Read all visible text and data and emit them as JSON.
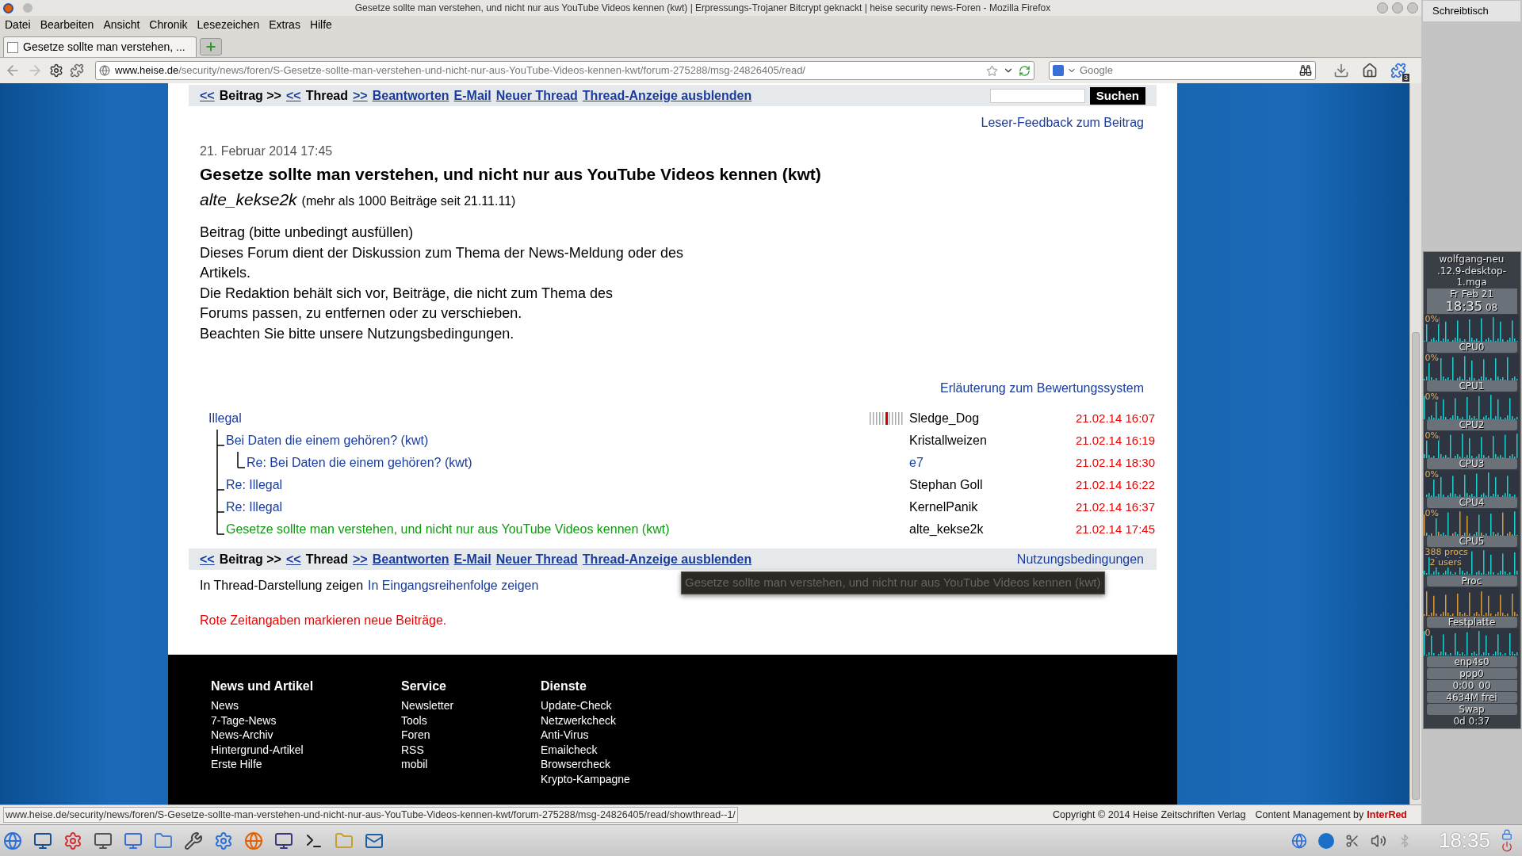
{
  "window": {
    "title": "Gesetze sollte man verstehen, und nicht nur aus YouTube Videos kennen (kwt) | Erpressungs-Trojaner Bitcrypt geknackt | heise security news-Foren - Mozilla Firefox"
  },
  "desktop_button": "Schreibtisch",
  "menu": [
    "Datei",
    "Bearbeiten",
    "Ansicht",
    "Chronik",
    "Lesezeichen",
    "Extras",
    "Hilfe"
  ],
  "tabs": [
    {
      "label": "Gesetze sollte man verstehen, ...",
      "selected": true
    }
  ],
  "address": {
    "host": "www.heise.de",
    "path": "/security/news/foren/S-Gesetze-sollte-man-verstehen-und-nicht-nur-aus-YouTube-Videos-kennen-kwt/forum-275288/msg-24826405/read/"
  },
  "search_engine": {
    "placeholder": "Google"
  },
  "addon_badge": "3",
  "forum_nav_top": {
    "items": [
      {
        "kind": "link",
        "text": "<<"
      },
      {
        "kind": "label",
        "text": "Beitrag >>"
      },
      {
        "kind": "link",
        "text": "<<"
      },
      {
        "kind": "label",
        "text": "Thread"
      },
      {
        "kind": "link",
        "text": ">>"
      },
      {
        "kind": "link",
        "text": "Beantworten"
      },
      {
        "kind": "link",
        "text": "E-Mail"
      },
      {
        "kind": "link",
        "text": "Neuer Thread"
      },
      {
        "kind": "link",
        "text": "Thread-Anzeige ausblenden"
      }
    ],
    "search_button": "Suchen"
  },
  "feedback_link": "Leser-Feedback zum Beitrag",
  "post": {
    "date": "21. Februar 2014 17:45",
    "title": "Gesetze sollte man verstehen, und nicht nur aus YouTube Videos kennen (kwt)",
    "author": "alte_kekse2k",
    "author_info": "(mehr als 1000 Beiträge seit 21.11.11)",
    "body": [
      "Beitrag (bitte unbedingt ausfüllen)",
      "Dieses Forum dient der Diskussion zum Thema der News-Meldung oder des",
      "Artikels.",
      "Die Redaktion behält sich vor, Beiträge, die nicht zum Thema des",
      "Forums passen, zu entfernen oder zu verschieben.",
      "Beachten Sie bitte unsere Nutzungsbedingungen."
    ]
  },
  "rating_link": "Erläuterung zum Bewertungssystem",
  "thread": [
    {
      "title": "Illegal",
      "author": "Sledge_Dog",
      "author_link": false,
      "time": "21.02.14 16:07",
      "new": true,
      "rated": true,
      "current": false,
      "children": [
        {
          "title": "Bei Daten die einem gehören? (kwt)",
          "author": "Kristallweizen",
          "author_link": false,
          "time": "21.02.14 16:19",
          "new": true,
          "rated": false,
          "current": false,
          "children": [
            {
              "title": "Re: Bei Daten die einem gehören? (kwt)",
              "author": "e7",
              "author_link": true,
              "time": "21.02.14 18:30",
              "new": true,
              "rated": false,
              "current": false
            }
          ]
        },
        {
          "title": "Re: Illegal",
          "author": "Stephan Goll",
          "author_link": false,
          "time": "21.02.14 16:22",
          "new": true,
          "rated": false,
          "current": false
        },
        {
          "title": "Re: Illegal",
          "author": "KernelPanik",
          "author_link": false,
          "time": "21.02.14 16:37",
          "new": true,
          "rated": false,
          "current": false
        },
        {
          "title": "Gesetze sollte man verstehen, und nicht nur aus YouTube Videos kennen (kwt)",
          "author": "alte_kekse2k",
          "author_link": false,
          "time": "21.02.14 17:45",
          "new": true,
          "rated": false,
          "current": true
        }
      ]
    }
  ],
  "forum_nav_bottom": {
    "items": [
      {
        "kind": "link",
        "text": "<<"
      },
      {
        "kind": "label",
        "text": "Beitrag >>"
      },
      {
        "kind": "link",
        "text": "<<"
      },
      {
        "kind": "label",
        "text": "Thread"
      },
      {
        "kind": "link",
        "text": ">>"
      },
      {
        "kind": "link",
        "text": "Beantworten"
      },
      {
        "kind": "link",
        "text": "E-Mail"
      },
      {
        "kind": "link",
        "text": "Neuer Thread"
      },
      {
        "kind": "link",
        "text": "Thread-Anzeige ausblenden"
      }
    ],
    "terms_link": "Nutzungsbedingungen"
  },
  "view_options": [
    {
      "text": "In Thread-Darstellung zeigen",
      "selected": true
    },
    {
      "text": "In Eingangsreihenfolge zeigen",
      "selected": false
    }
  ],
  "tooltip": "Gesetze sollte man verstehen, und nicht nur aus YouTube Videos kennen (kwt)",
  "legend_note": "Rote Zeitangaben markieren neue Beiträge.",
  "footer": [
    {
      "heading": "News und Artikel",
      "links": [
        "News",
        "7-Tage-News",
        "News-Archiv",
        "Hintergrund-Artikel",
        "Erste Hilfe"
      ]
    },
    {
      "heading": "Service",
      "links": [
        "Newsletter",
        "Tools",
        "Foren",
        "RSS",
        "mobil"
      ]
    },
    {
      "heading": "Dienste",
      "links": [
        "Update-Check",
        "Netzwerkcheck",
        "Anti-Virus",
        "Emailcheck",
        "Browsercheck",
        "Krypto-Kampagne"
      ]
    }
  ],
  "status_bar": {
    "url": "www.heise.de/security/news/foren/S-Gesetze-sollte-man-verstehen-und-nicht-nur-aus-YouTube-Videos-kennen-kwt/forum-275288/msg-24826405/read/showthread--1/",
    "copyright": "Copyright © 2014 Heise Zeitschriften Verlag",
    "cms_label": "Content Management by",
    "cms_brand": "InterRed"
  },
  "gkrellm": {
    "host": "wolfgang-neu",
    "kernel": ".12.9-desktop-1.mga",
    "date": "Fr Feb 21",
    "time": "18:35",
    "seconds": "08",
    "cpus": [
      {
        "reading": "0%",
        "label": "CPU0"
      },
      {
        "reading": "0%",
        "label": "CPU1"
      },
      {
        "reading": "0%",
        "label": "CPU2"
      },
      {
        "reading": "0%",
        "label": "CPU3"
      },
      {
        "reading": "0%",
        "label": "CPU4"
      },
      {
        "reading": "0%",
        "label": "CPU5"
      }
    ],
    "proc": {
      "procs": "388 procs",
      "users": "2 users",
      "label": "Proc"
    },
    "disk": {
      "label": "Festplatte"
    },
    "net": {
      "reading": "0",
      "interfaces": [
        "enp4s0",
        "ppp0"
      ],
      "timer": "0:00",
      "timer_seconds": "00"
    },
    "memory": {
      "free": "4634M frei",
      "label": "Swap"
    },
    "uptime": "0d 0:37"
  },
  "taskbar": {
    "clock": "18:35"
  }
}
